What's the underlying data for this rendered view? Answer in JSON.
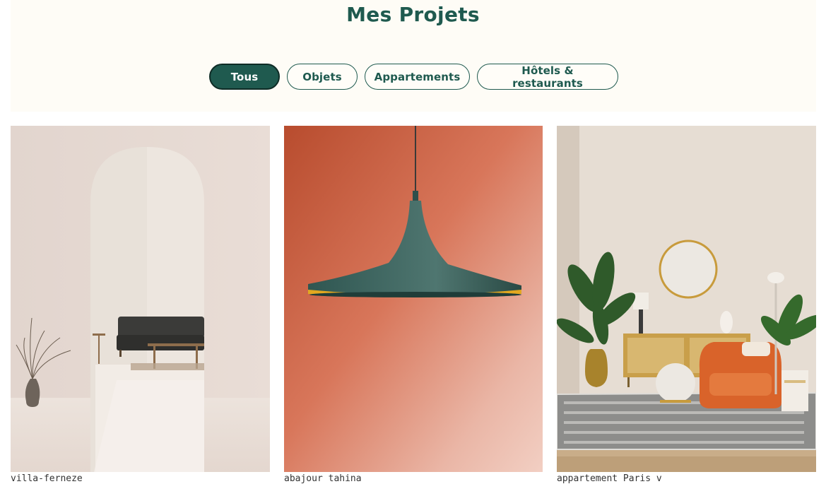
{
  "page": {
    "title": "Mes Projets"
  },
  "filters": [
    {
      "label": "Tous",
      "active": true
    },
    {
      "label": "Objets",
      "active": false
    },
    {
      "label": "Appartements",
      "active": false
    },
    {
      "label": "Hôtels & restaurants",
      "active": false
    }
  ],
  "projects": [
    {
      "title": "villa-ferneze",
      "image": "white arched room with dark sofa and dried grass vase"
    },
    {
      "title": "abajour tahina",
      "image": "teal pendant lamp on orange wall"
    },
    {
      "title": "appartement Paris v",
      "image": "living room with plants, orange armchair and rattan sideboard"
    }
  ],
  "colors": {
    "accent": "#1f5a4f",
    "header_bg": "#fefcf6",
    "active_border": "#0f2c26"
  }
}
